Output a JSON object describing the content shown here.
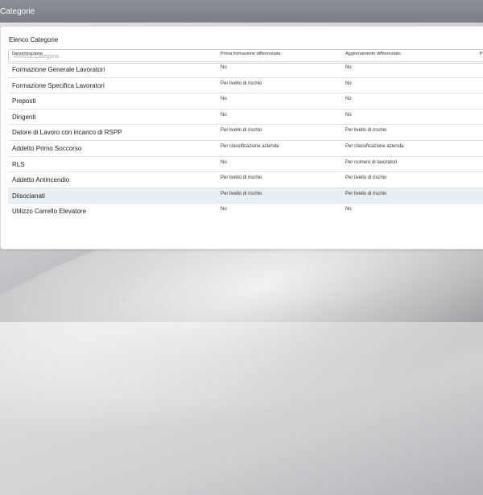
{
  "header": {
    "title": "Categorie"
  },
  "panel": {
    "title": "Elenco Categorie",
    "search_placeholder": "Ricerca Categoria"
  },
  "table": {
    "columns": [
      "Denominazione",
      "Prima formazione differenziata",
      "Aggiornamento differenziato",
      "P"
    ],
    "rows": [
      [
        "Formazione Generale Lavoratori",
        "No",
        "No"
      ],
      [
        "Formazione Specifica Lavoratori",
        "Per livello di rischio",
        "No"
      ],
      [
        "Preposti",
        "No",
        "No"
      ],
      [
        "Dirigenti",
        "No",
        "No"
      ],
      [
        "Datore di Lavoro con incarico di RSPP",
        "Per livello di rischio",
        "Per livello di rischio"
      ],
      [
        "Addetto Primo Soccorso",
        "Per classificazione azienda",
        "Per classificazione azienda"
      ],
      [
        "RLS",
        "No",
        "Per numero di lavoratori"
      ],
      [
        "Addetto Antincendio",
        "Per livello di rischio",
        "Per livello di rischio"
      ],
      [
        "Diisocianati",
        "Per livello di rischio",
        "Per livello di rischio"
      ],
      [
        "Utilizzo Carrello Elevatore",
        "No",
        "No"
      ]
    ],
    "highlighted_row_index": 8
  }
}
